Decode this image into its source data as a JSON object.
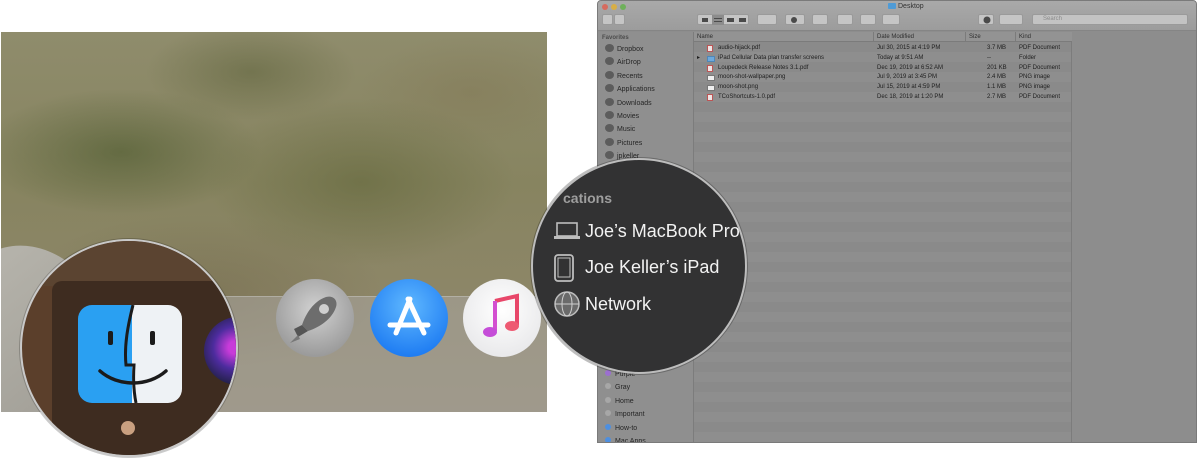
{
  "dock": {
    "apps": [
      "finder",
      "siri",
      "launchpad",
      "app-store",
      "music"
    ]
  },
  "finder": {
    "window_title": "Desktop",
    "search_placeholder": "Search",
    "sidebar": {
      "favorites_header": "Favorites",
      "favorites": [
        {
          "label": "Dropbox",
          "icon": "dropbox-icon"
        },
        {
          "label": "AirDrop",
          "icon": "airdrop-icon"
        },
        {
          "label": "Recents",
          "icon": "recents-icon"
        },
        {
          "label": "Applications",
          "icon": "applications-icon"
        },
        {
          "label": "Downloads",
          "icon": "downloads-icon"
        },
        {
          "label": "Movies",
          "icon": "movies-icon"
        },
        {
          "label": "Music",
          "icon": "music-icon"
        },
        {
          "label": "Pictures",
          "icon": "pictures-icon"
        },
        {
          "label": "jpkeller",
          "icon": "home-icon"
        }
      ],
      "tags": [
        {
          "label": "Purple",
          "color": "#9b6fd0"
        },
        {
          "label": "Gray",
          "color": "#a7a7a7"
        },
        {
          "label": "Home",
          "color": "#a7a7a7"
        },
        {
          "label": "Important",
          "color": "#a7a7a7"
        },
        {
          "label": "How-to",
          "color": "#4d8fe0"
        },
        {
          "label": "Mac Apps",
          "color": "#4d8fe0"
        }
      ]
    },
    "columns": [
      "Name",
      "Date Modified",
      "Size",
      "Kind"
    ],
    "files": [
      {
        "name": "audio-hijack.pdf",
        "date": "Jul 30, 2015 at 4:19 PM",
        "size": "3.7 MB",
        "kind": "PDF Document",
        "type": "pdf"
      },
      {
        "name": "iPad Cellular Data plan transfer screens",
        "date": "Today at 9:51 AM",
        "size": "--",
        "kind": "Folder",
        "type": "folder"
      },
      {
        "name": "Loupedeck Release Notes 3.1.pdf",
        "date": "Dec 19, 2019 at 6:52 AM",
        "size": "201 KB",
        "kind": "PDF Document",
        "type": "pdf"
      },
      {
        "name": "moon-shot-wallpaper.png",
        "date": "Jul 9, 2019 at 3:45 PM",
        "size": "2.4 MB",
        "kind": "PNG image",
        "type": "png"
      },
      {
        "name": "moon-shot.png",
        "date": "Jul 15, 2019 at 4:59 PM",
        "size": "1.1 MB",
        "kind": "PNG image",
        "type": "png"
      },
      {
        "name": "TCoShortcuts-1.0.pdf",
        "date": "Dec 18, 2019 at 1:20 PM",
        "size": "2.7 MB",
        "kind": "PDF Document",
        "type": "pdf"
      }
    ]
  },
  "locations_zoom": {
    "header": "cations",
    "items": [
      {
        "label": "Joe’s MacBook Pro",
        "icon": "laptop-icon"
      },
      {
        "label": "Joe Keller’s iPad",
        "icon": "ipad-icon"
      },
      {
        "label": "Network",
        "icon": "network-icon"
      }
    ]
  }
}
